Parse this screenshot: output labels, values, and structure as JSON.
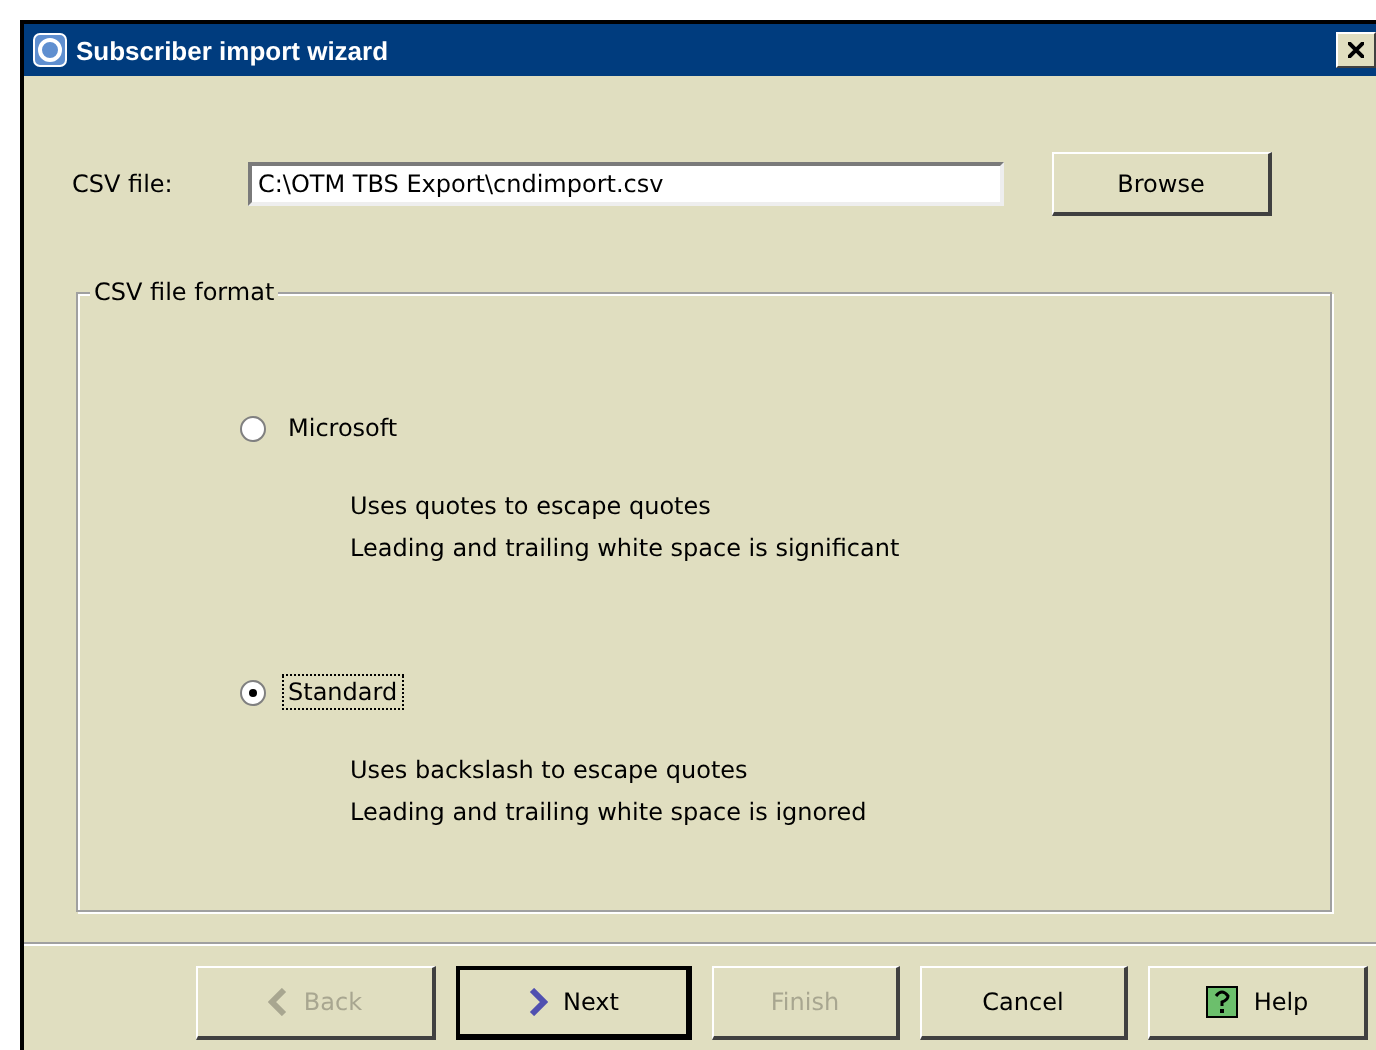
{
  "window": {
    "title": "Subscriber import wizard"
  },
  "csv_file": {
    "label": "CSV file:",
    "value": "C:\\OTM TBS Export\\cndimport.csv",
    "browse_button": "Browse"
  },
  "format_group": {
    "title": "CSV file format",
    "options": [
      {
        "label": "Microsoft",
        "selected": false,
        "focused": false,
        "description": [
          "Uses quotes to escape quotes",
          "Leading and trailing white space is significant"
        ]
      },
      {
        "label": "Standard",
        "selected": true,
        "focused": true,
        "description": [
          "Uses backslash to escape quotes",
          "Leading and trailing white space is ignored"
        ]
      }
    ]
  },
  "buttons": [
    {
      "kind": "back",
      "label": "Back",
      "disabled": true,
      "default": false
    },
    {
      "kind": "next",
      "label": "Next",
      "disabled": false,
      "default": true
    },
    {
      "kind": "finish",
      "label": "Finish",
      "disabled": true,
      "default": false
    },
    {
      "kind": "cancel",
      "label": "Cancel",
      "disabled": false,
      "default": false
    },
    {
      "kind": "help",
      "label": "Help",
      "disabled": false,
      "default": false
    }
  ]
}
